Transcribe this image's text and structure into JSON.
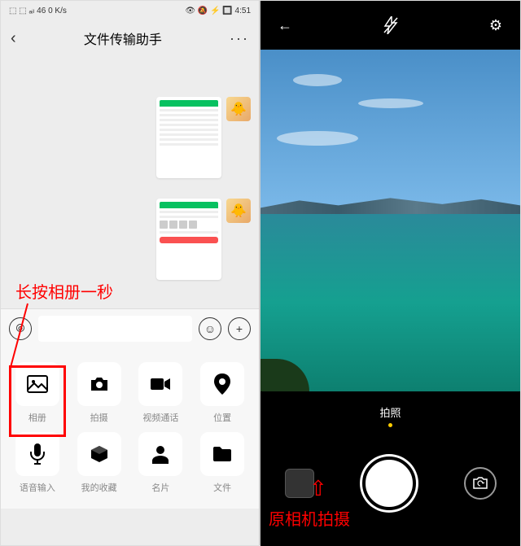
{
  "left": {
    "status": {
      "left_text": "⬚ ⬚ ₐᵢₗ 46 0 K/s",
      "right_text": "👁 🔕 ⚡ 🔲 4:51"
    },
    "nav": {
      "back": "‹",
      "title": "文件传输助手",
      "more": "···"
    },
    "annotation": "长按相册一秒",
    "inputbar": {
      "voice_glyph": "⦾",
      "emoji_glyph": "☺",
      "plus_glyph": "+"
    },
    "actions": [
      {
        "icon": "image-icon",
        "glyph": "🖼",
        "label": "相册"
      },
      {
        "icon": "camera-icon",
        "glyph": "📷",
        "label": "拍摄"
      },
      {
        "icon": "video-call-icon",
        "glyph": "■",
        "label": "视频通话"
      },
      {
        "icon": "location-icon",
        "glyph": "📍",
        "label": "位置"
      },
      {
        "icon": "voice-input-icon",
        "glyph": "🎙",
        "label": "语音输入"
      },
      {
        "icon": "favorites-icon",
        "glyph": "📦",
        "label": "我的收藏"
      },
      {
        "icon": "contact-card-icon",
        "glyph": "👤",
        "label": "名片"
      },
      {
        "icon": "file-icon",
        "glyph": "📄",
        "label": "文件"
      }
    ]
  },
  "right": {
    "top": {
      "back": "←",
      "flash": "✕",
      "settings": "⚙"
    },
    "mode": {
      "active": "拍照"
    },
    "annotation": "原相机拍摄",
    "arrow": "⇧"
  },
  "colors": {
    "highlight": "#ff0000",
    "wechat_green": "#07c160"
  }
}
